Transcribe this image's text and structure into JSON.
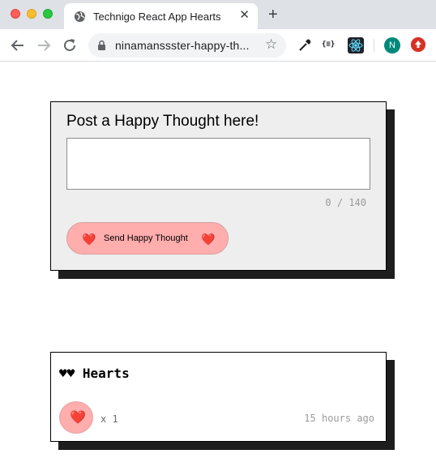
{
  "browser": {
    "tab_title": "Technigo React App Hearts",
    "tab_close": "✕",
    "new_tab": "+",
    "url": "ninamanssster-happy-th...",
    "bookmark_star": "☆",
    "json_ext": "{≡}",
    "profile_initial": "N",
    "icons": {
      "back": "arrow-left-icon",
      "forward": "arrow-right-icon",
      "reload": "reload-icon",
      "lock": "lock-icon",
      "eyedropper": "eyedropper-icon",
      "react": "react-devtools-icon",
      "update": "update-icon"
    }
  },
  "form": {
    "title": "Post a Happy Thought here!",
    "textarea_value": "",
    "counter": "0 / 140",
    "button_label": "Send Happy Thought",
    "heart": "❤️"
  },
  "thought": {
    "message": "♥♥ Hearts",
    "like_heart": "❤️",
    "like_count": "x 1",
    "time": "15 hours ago"
  },
  "colors": {
    "card_bg": "#efeeee",
    "button_pink": "#ffadad",
    "shadow": "#1e1e1e",
    "muted_text": "#9a9a9a"
  }
}
